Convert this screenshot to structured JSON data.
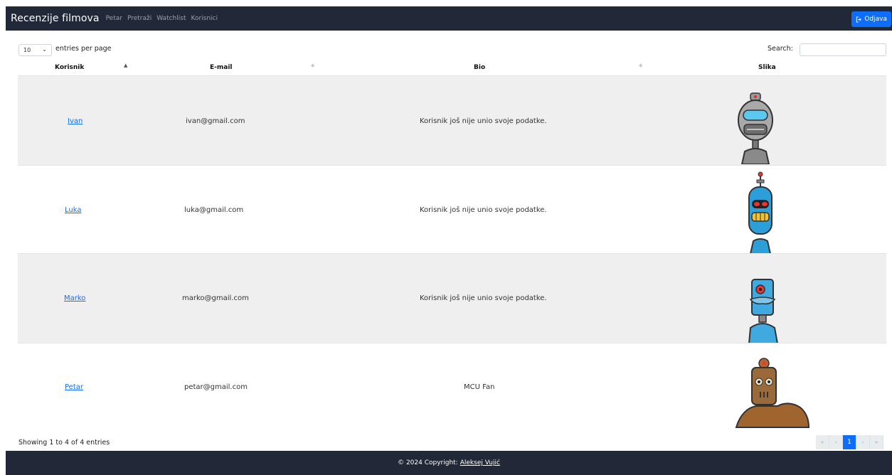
{
  "navbar": {
    "brand": "Recenzije filmova",
    "links": [
      "Petar",
      "Pretraži",
      "Watchlist",
      "Korisnici"
    ],
    "logout_label": "Odjava"
  },
  "controls": {
    "page_length": "10",
    "entries_label": "entries per page",
    "search_label": "Search:",
    "search_value": ""
  },
  "table": {
    "columns": [
      "Korisnik",
      "E-mail",
      "Bio",
      "Slika"
    ],
    "rows": [
      {
        "user": "Ivan",
        "email": "ivan@gmail.com",
        "bio": "Korisnik još nije unio svoje podatke.",
        "avatar": "gray-robot-icon"
      },
      {
        "user": "Luka",
        "email": "luka@gmail.com",
        "bio": "Korisnik još nije unio svoje podatke.",
        "avatar": "blue-robot-icon"
      },
      {
        "user": "Marko",
        "email": "marko@gmail.com",
        "bio": "Korisnik još nije unio svoje podatke.",
        "avatar": "cyan-robot-icon"
      },
      {
        "user": "Petar",
        "email": "petar@gmail.com",
        "bio": "MCU Fan",
        "avatar": "brown-robot-icon"
      }
    ]
  },
  "pagination": {
    "info": "Showing 1 to 4 of 4 entries",
    "first": "«",
    "prev": "‹",
    "current": "1",
    "next": "›",
    "last": "»"
  },
  "footer": {
    "copyright": "© 2024 Copyright:",
    "author": "Aleksej Vujić"
  },
  "colors": {
    "navbar_bg": "#212838",
    "accent": "#0d6efd",
    "stripe": "#efefef"
  }
}
